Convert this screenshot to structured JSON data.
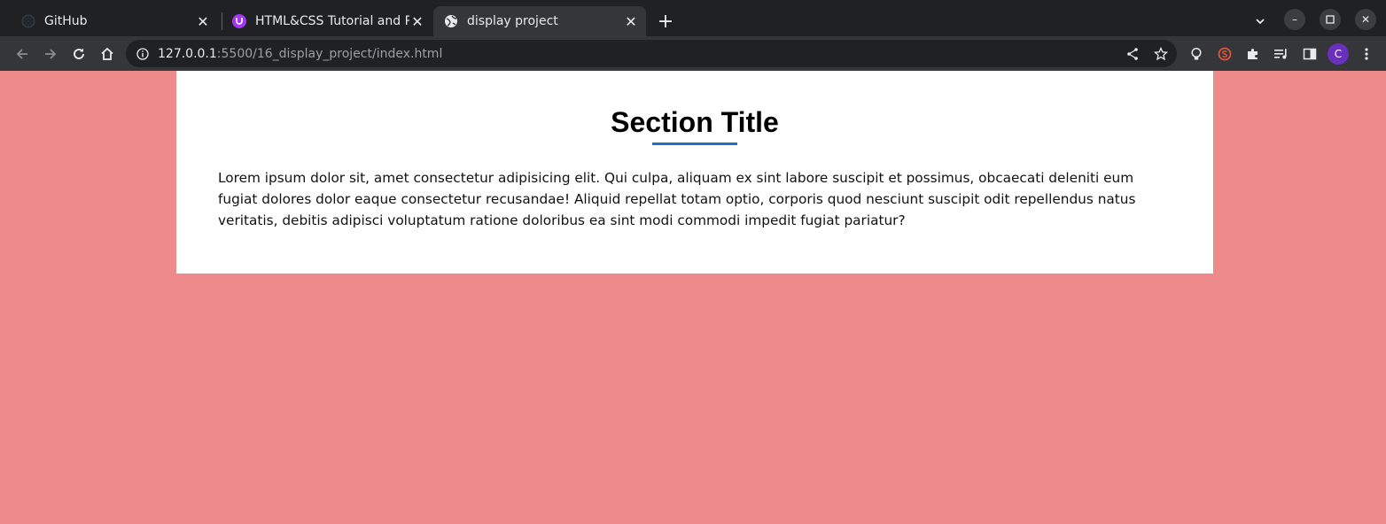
{
  "browser": {
    "tabs": [
      {
        "title": "GitHub",
        "favicon": "github-icon",
        "active": false
      },
      {
        "title": "HTML&CSS Tutorial and P",
        "favicon": "udemy-icon",
        "active": false
      },
      {
        "title": "display project",
        "favicon": "globe-icon",
        "active": true
      }
    ],
    "url_host": "127.0.0.1",
    "url_rest": ":5500/16_display_project/index.html",
    "profile_initial": "C",
    "colors": {
      "tabstrip": "#202124",
      "toolbar": "#35363a",
      "avatar": "#6b2fbe"
    }
  },
  "page": {
    "background_color": "#ee8a8a",
    "section_title": "Section Title",
    "underline_color": "#1a73c8",
    "paragraph": "Lorem ipsum dolor sit, amet consectetur adipisicing elit. Qui culpa, aliquam ex sint labore suscipit et possimus, obcaecati deleniti eum fugiat dolores dolor eaque consectetur recusandae! Aliquid repellat totam optio, corporis quod nesciunt suscipit odit repellendus natus veritatis, debitis adipisci voluptatum ratione doloribus ea sint modi commodi impedit fugiat pariatur?"
  }
}
